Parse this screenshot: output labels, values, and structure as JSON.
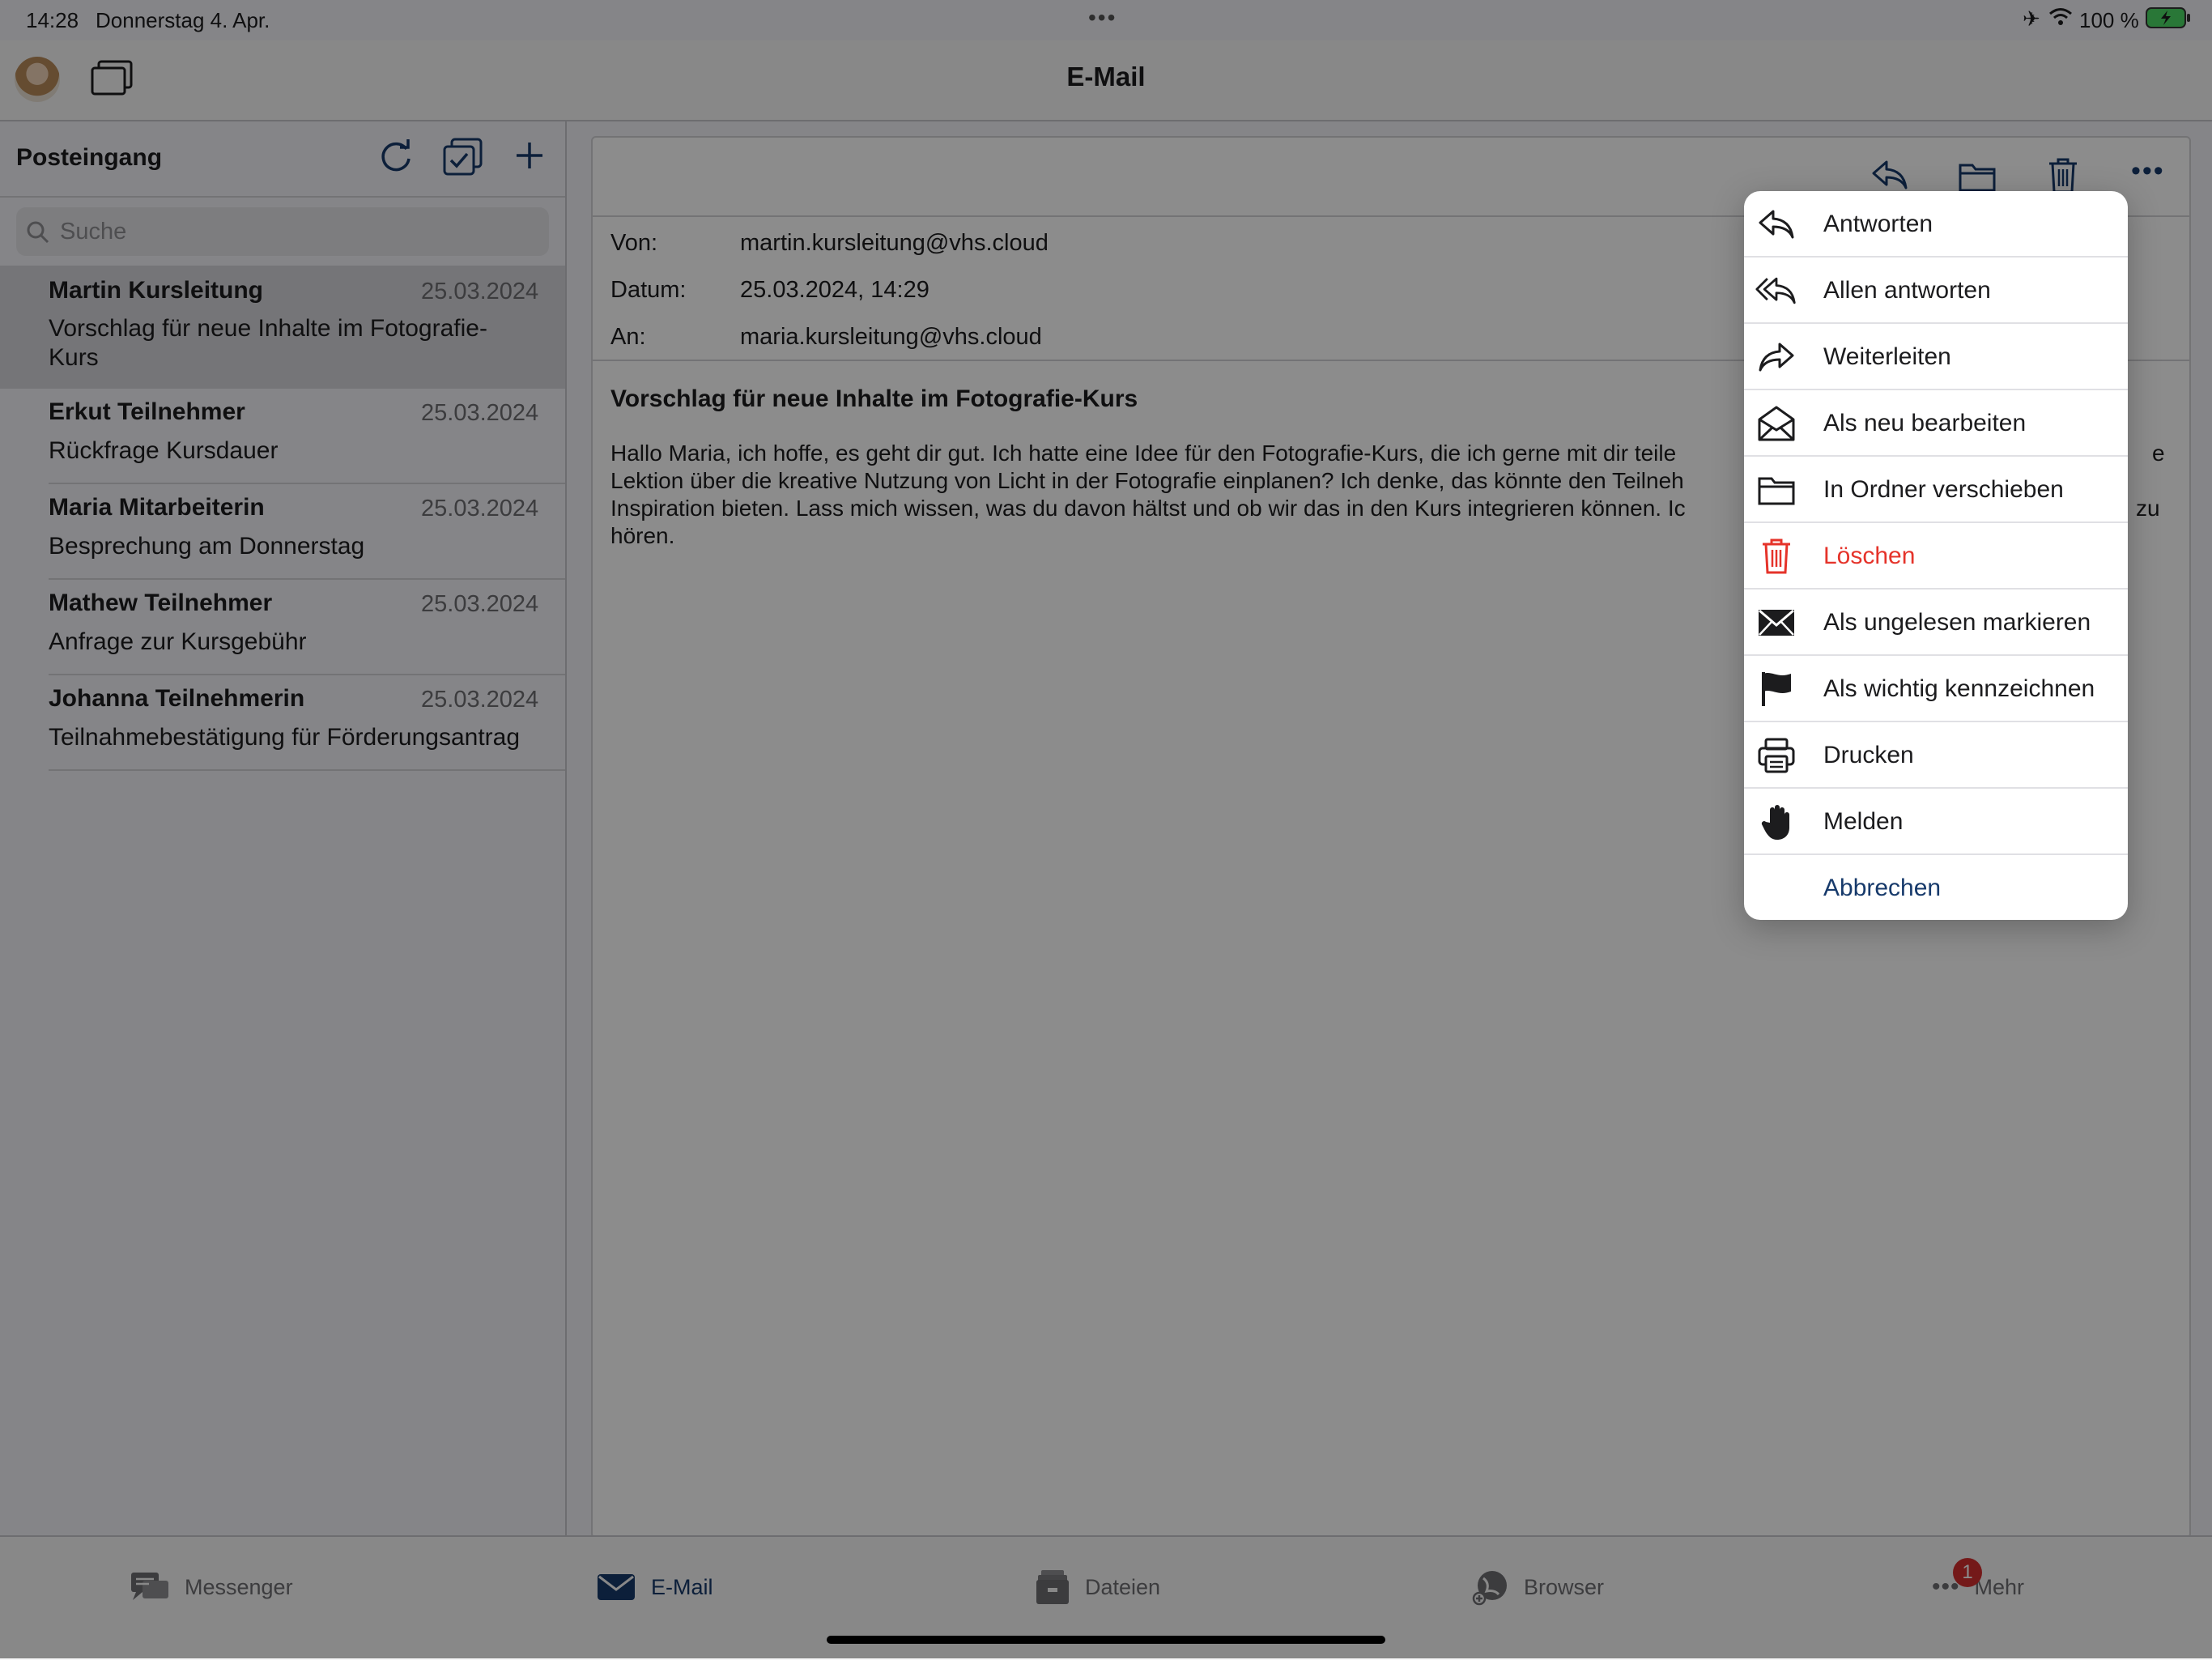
{
  "status": {
    "time": "14:28",
    "date": "Donnerstag 4. Apr.",
    "battery": "100 %"
  },
  "header": {
    "title": "E-Mail"
  },
  "inbox": {
    "title": "Posteingang",
    "search_placeholder": "Suche",
    "items": [
      {
        "sender": "Martin Kursleitung",
        "date": "25.03.2024",
        "subject": "Vorschlag für neue Inhalte im Fotografie-Kurs"
      },
      {
        "sender": "Erkut Teilnehmer",
        "date": "25.03.2024",
        "subject": "Rückfrage Kursdauer"
      },
      {
        "sender": "Maria Mitarbeiterin",
        "date": "25.03.2024",
        "subject": "Besprechung am Donnerstag"
      },
      {
        "sender": "Mathew Teilnehmer",
        "date": "25.03.2024",
        "subject": "Anfrage zur Kursgebühr"
      },
      {
        "sender": "Johanna Teilnehmerin",
        "date": "25.03.2024",
        "subject": "Teilnahmebestätigung für Förderungsantrag"
      }
    ]
  },
  "message": {
    "from_label": "Von:",
    "from": "martin.kursleitung@vhs.cloud",
    "date_label": "Datum:",
    "date": "25.03.2024, 14:29",
    "to_label": "An:",
    "to": "maria.kursleitung@vhs.cloud",
    "subject": "Vorschlag für neue Inhalte im Fotografie-Kurs",
    "body_line1_left": "Hallo Maria, ich hoffe, es geht dir gut. Ich hatte eine Idee für den Fotografie-Kurs, die ich gerne mit dir teile",
    "body_line1_right": "e",
    "body_line2_left": "Lektion über die kreative Nutzung von Licht in der Fotografie einplanen? Ich denke, das könnte den Teilneh",
    "body_line3_left": "Inspiration bieten. Lass mich wissen, was du davon hältst und ob wir das in den Kurs integrieren können. Ic",
    "body_line3_right": "zu",
    "body_line4": "hören."
  },
  "menu": {
    "items": [
      {
        "label": "Antworten",
        "icon": "reply-icon"
      },
      {
        "label": "Allen antworten",
        "icon": "reply-all-icon"
      },
      {
        "label": "Weiterleiten",
        "icon": "forward-icon"
      },
      {
        "label": "Als neu bearbeiten",
        "icon": "envelope-open-icon"
      },
      {
        "label": "In Ordner verschieben",
        "icon": "folder-icon"
      },
      {
        "label": "Löschen",
        "icon": "trash-icon"
      },
      {
        "label": "Als ungelesen markieren",
        "icon": "envelope-icon"
      },
      {
        "label": "Als wichtig kennzeichnen",
        "icon": "flag-icon"
      },
      {
        "label": "Drucken",
        "icon": "printer-icon"
      },
      {
        "label": "Melden",
        "icon": "hand-icon"
      },
      {
        "label": "Abbrechen"
      }
    ]
  },
  "tabs": [
    {
      "label": "Messenger",
      "icon": "messenger-icon"
    },
    {
      "label": "E-Mail",
      "icon": "mail-icon"
    },
    {
      "label": "Dateien",
      "icon": "files-icon"
    },
    {
      "label": "Browser",
      "icon": "browser-icon"
    },
    {
      "label": "Mehr",
      "icon": "more-icon",
      "badge": "1"
    }
  ],
  "colors": {
    "accent": "#173a6b",
    "danger": "#e5332a",
    "badge": "#d32f2f"
  }
}
